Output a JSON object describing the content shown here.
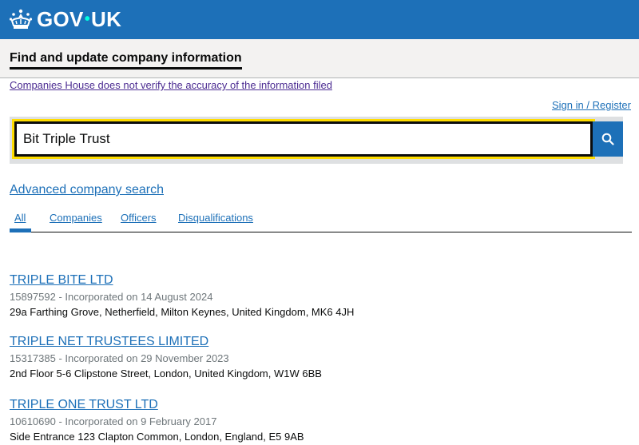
{
  "header": {
    "logo_text_left": "GOV",
    "logo_dot": "•",
    "logo_text_right": "UK",
    "logo_icon": "crown-icon"
  },
  "service": {
    "name": "Find and update company information"
  },
  "disclaimer": "Companies House does not verify the accuracy of the information filed",
  "signin": "Sign in / Register",
  "search": {
    "value": "Bit Triple Trust",
    "button_icon": "search-icon"
  },
  "advanced_search": "Advanced company search",
  "tabs": [
    {
      "label": "All",
      "active": true
    },
    {
      "label": "Companies",
      "active": false
    },
    {
      "label": "Officers",
      "active": false
    },
    {
      "label": "Disqualifications",
      "active": false
    }
  ],
  "results": [
    {
      "name": "TRIPLE BITE LTD",
      "meta": "15897592 - Incorporated on 14 August 2024",
      "address": "29a Farthing Grove, Netherfield, Milton Keynes, United Kingdom, MK6 4JH"
    },
    {
      "name": "TRIPLE NET TRUSTEES LIMITED",
      "meta": "15317385 - Incorporated on 29 November 2023",
      "address": "2nd Floor 5-6 Clipstone Street, London, United Kingdom, W1W 6BB"
    },
    {
      "name": "TRIPLE ONE TRUST LTD",
      "meta": "10610690 - Incorporated on 9 February 2017",
      "address": "Side Entrance 123 Clapton Common, London, England, E5 9AB"
    }
  ],
  "colors": {
    "header_blue": "#1d70b8",
    "link_blue": "#1d70b8",
    "visited_purple": "#4c2c92",
    "focus_yellow": "#ffdd00",
    "meta_grey": "#6f777b"
  }
}
